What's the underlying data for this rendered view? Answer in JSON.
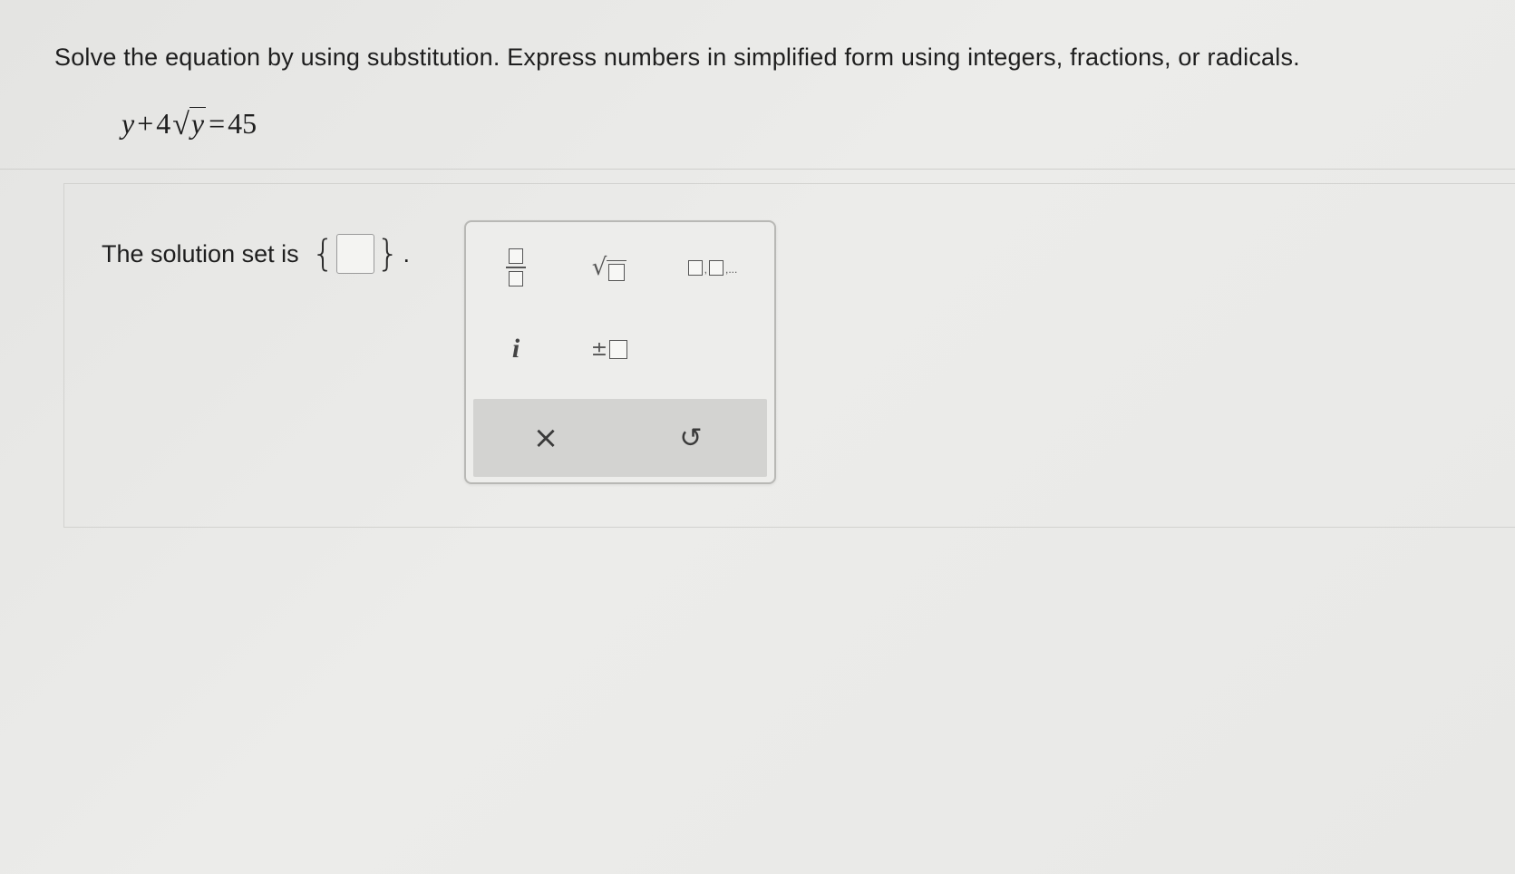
{
  "question": {
    "instruction": "Solve the equation by using substitution. Express numbers in simplified form using integers, fractions, or radicals.",
    "equation": {
      "var1": "y",
      "plus": "+",
      "coef": "4",
      "radicand": "y",
      "equals": "=",
      "rhs": "45"
    }
  },
  "answer": {
    "label": "The solution set is",
    "open_brace": "{",
    "close_brace": "}",
    "period": ".",
    "value": ""
  },
  "palette": {
    "buttons": [
      {
        "name": "fraction",
        "icon": "fraction-icon"
      },
      {
        "name": "square-root",
        "icon": "sqrt-icon"
      },
      {
        "name": "list",
        "icon": "list-icon",
        "suffix": ",..."
      },
      {
        "name": "imaginary",
        "icon": "imaginary-i-icon",
        "symbol": "i"
      },
      {
        "name": "plus-minus",
        "icon": "plus-minus-icon",
        "symbol": "±"
      }
    ],
    "footer": {
      "clear_symbol": "×",
      "undo_symbol": "↺"
    }
  }
}
